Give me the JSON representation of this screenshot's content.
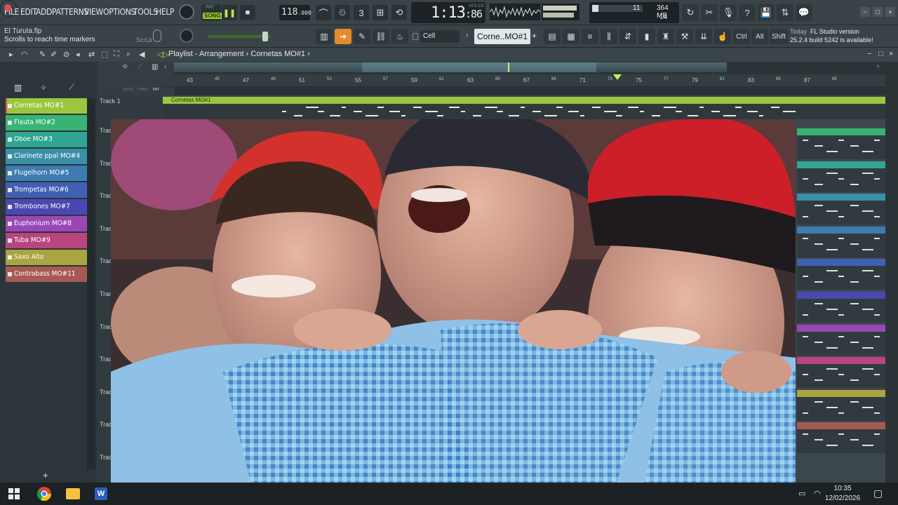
{
  "menu": [
    "FILE",
    "EDIT",
    "ADD",
    "PATTERNS",
    "VIEW",
    "OPTIONS",
    "TOOLS",
    "HELP"
  ],
  "transport": {
    "pat_label": "PAT",
    "song_label": "SONG",
    "tempo": "118",
    "tempo_decimal": ".000",
    "time": "1:13",
    "time_sub": "86",
    "time_unit": "M:S:CS"
  },
  "cpu": {
    "voices": "11",
    "memory": "364 MB",
    "memory_sub": "14",
    "level": 0.12
  },
  "right_tools": [
    "↻",
    "✂",
    "🎙",
    "?",
    "💾",
    "⇅",
    "💬"
  ],
  "file": {
    "name": "El Turuta.flp",
    "hint": "Scrolls to reach time markers",
    "scrlk": "ScrLk"
  },
  "row2": {
    "snap": "Cell",
    "pattern": "Corne..MO#1",
    "modifier_keys": [
      "Ctrl",
      "Alt",
      "Shift"
    ]
  },
  "news": {
    "label": "Today",
    "title": "FL Studio version",
    "body": "25.2.4 build 5242 is available!"
  },
  "playlist": {
    "breadcrumb_1": "Playlist - Arrangement",
    "breadcrumb_2": "Cornetas MO#1"
  },
  "mode_labels": {
    "note": "NOTE",
    "chan": "CHAN",
    "pat": "PAT"
  },
  "patterns": [
    {
      "name": "Cornetas MO#1",
      "color": "#9cc63f"
    },
    {
      "name": "Flauta MO#2",
      "color": "#37b474"
    },
    {
      "name": "Oboe MO#3",
      "color": "#2fa592"
    },
    {
      "name": "Clarinete ppal MO#4",
      "color": "#3b8fa8"
    },
    {
      "name": "Flugelhorn MO#5",
      "color": "#3c7cb0"
    },
    {
      "name": "Trompetas MO#6",
      "color": "#4060b4"
    },
    {
      "name": "Trombones MO#7",
      "color": "#4a48b0"
    },
    {
      "name": "Euphonium MO#8",
      "color": "#9a47b6"
    },
    {
      "name": "Tuba MO#9",
      "color": "#b8457e"
    },
    {
      "name": "Saxo Alto",
      "color": "#a8a542"
    },
    {
      "name": "Contrabass MO#11",
      "color": "#a65a54"
    }
  ],
  "tracks": [
    "Track 1",
    "Trac",
    "Trac",
    "Trac",
    "Trac",
    "Trac",
    "Trac",
    "Trac",
    "Trac",
    "Trac",
    "Trac",
    "Trac"
  ],
  "ruler": [
    "43",
    "45",
    "47",
    "49",
    "51",
    "53",
    "55",
    "57",
    "59",
    "61",
    "63",
    "65",
    "67",
    "69",
    "71",
    "73",
    "75",
    "77",
    "79",
    "81",
    "83",
    "85",
    "87",
    "89"
  ],
  "clip": {
    "name": "Cornetas MO#1"
  },
  "add_button": "+",
  "taskbar": {
    "time": "10:35",
    "date": "12/02/2026"
  }
}
